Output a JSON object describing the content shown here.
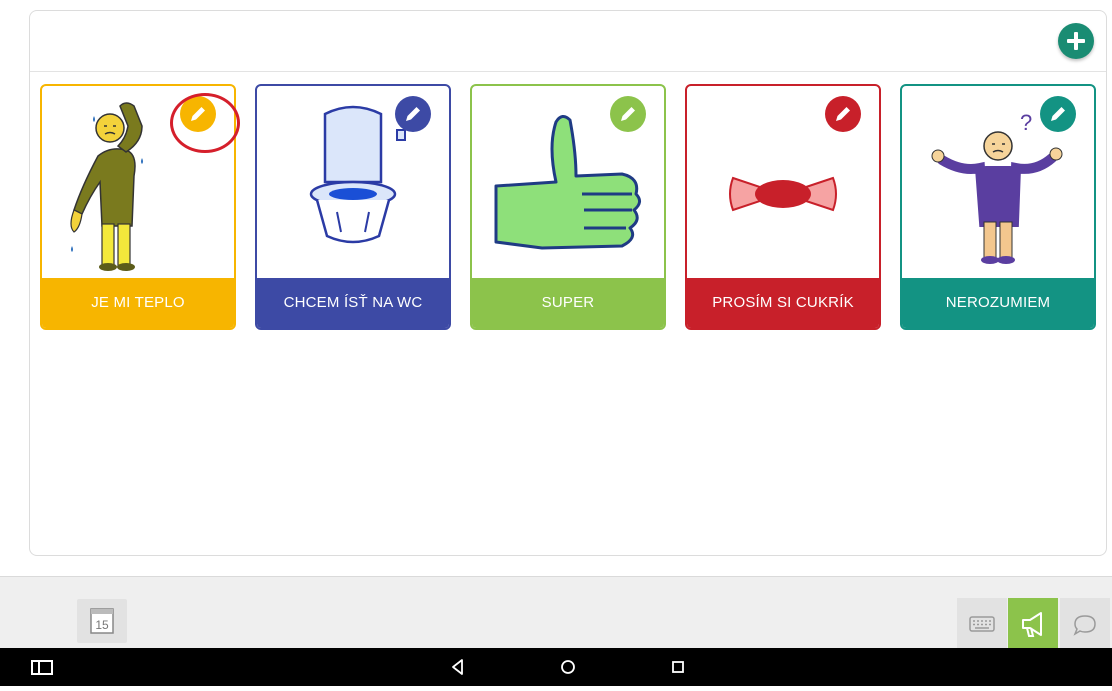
{
  "cards": [
    {
      "label": "JE MI TEPLO",
      "color": "#f7b500",
      "picture": "person-feeling-hot",
      "edit_icon": "pencil-icon"
    },
    {
      "label": "CHCEM ÍSŤ NA WC",
      "color": "#3d4aa5",
      "picture": "toilet",
      "edit_icon": "pencil-icon"
    },
    {
      "label": "SUPER",
      "color": "#8cc34b",
      "picture": "thumbs-up",
      "edit_icon": "pencil-icon"
    },
    {
      "label": "PROSÍM SI CUKRÍK",
      "color": "#c8202a",
      "picture": "candy",
      "edit_icon": "pencil-icon"
    },
    {
      "label": "NEROZUMIEM",
      "color": "#139383",
      "picture": "confused-person",
      "edit_icon": "pencil-icon"
    }
  ],
  "toolbar": {
    "add_icon": "plus-icon",
    "add_color": "#1a8c73",
    "calendar_day": "15",
    "keyboard_icon": "keyboard-icon",
    "speak_icon": "megaphone-icon",
    "speak_active_color": "#8cc34b",
    "chat_icon": "speech-bubble-icon"
  },
  "android_nav": [
    "recents-window-icon",
    "back-icon",
    "home-icon",
    "overview-icon"
  ]
}
